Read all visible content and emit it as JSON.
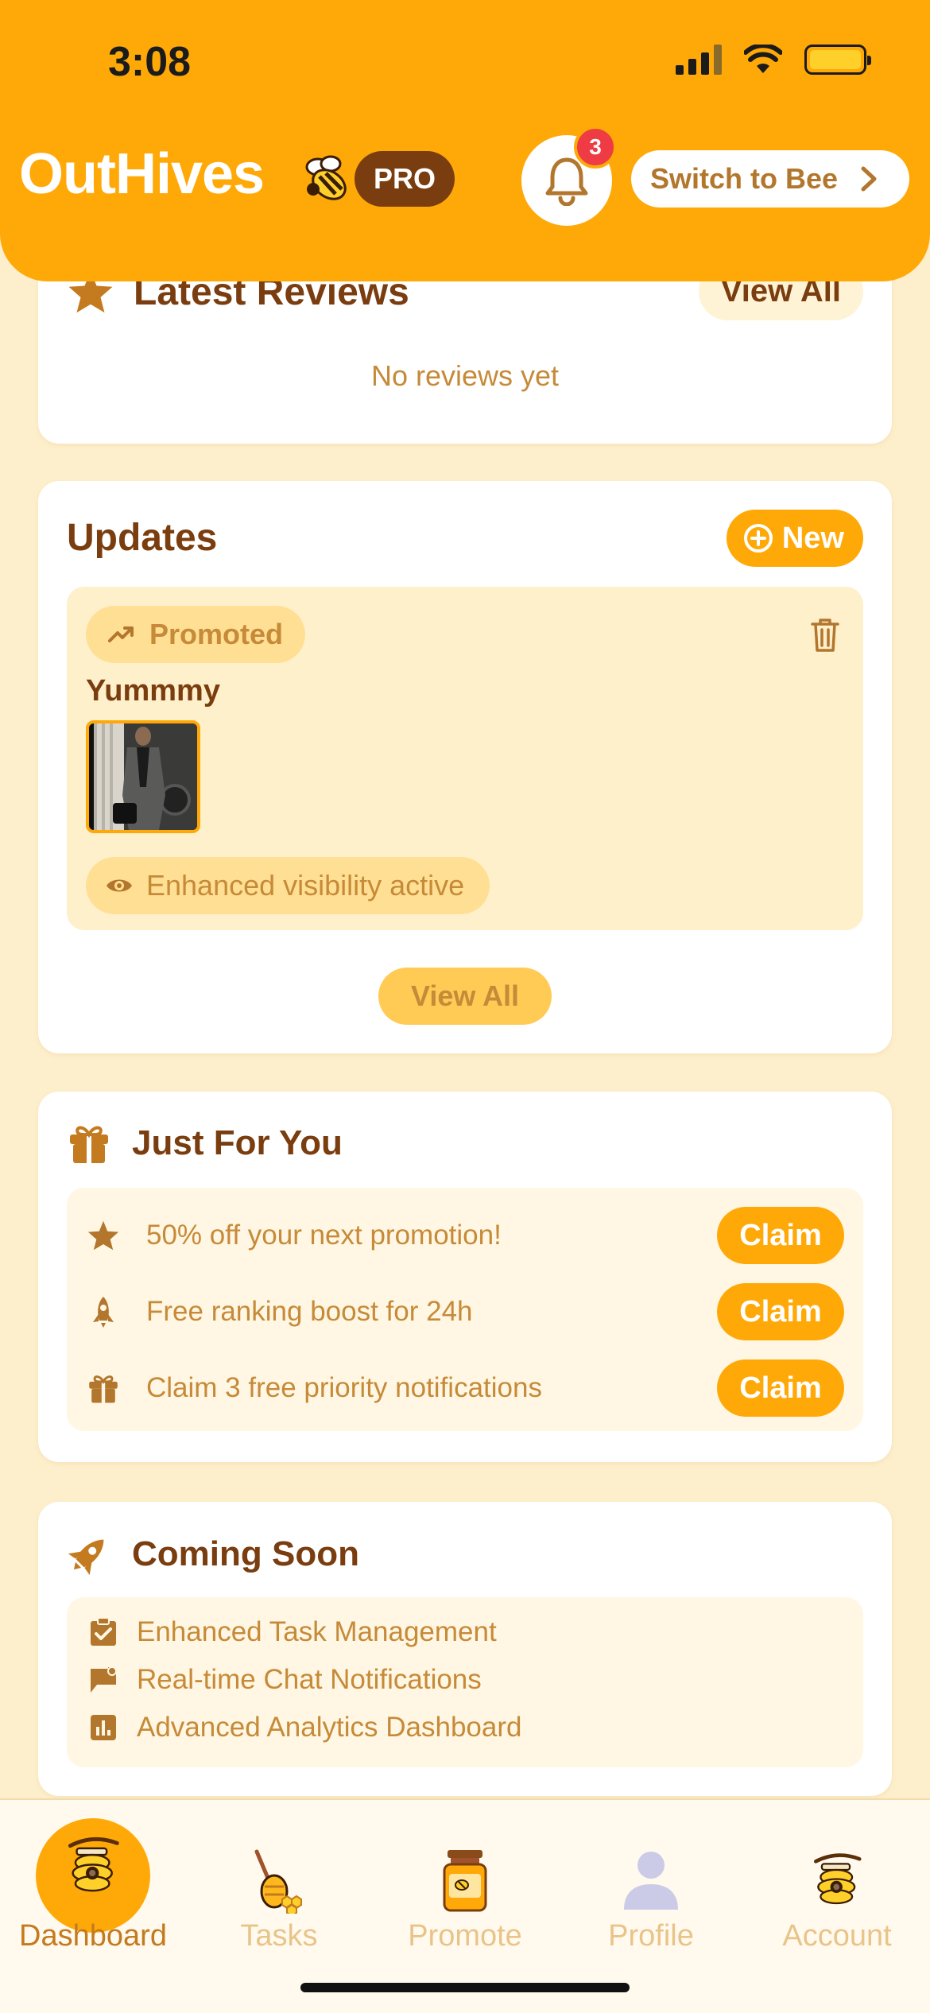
{
  "status_bar": {
    "time": "3:08"
  },
  "header": {
    "brand": "OutHives",
    "badge": "PRO",
    "notification_count": "3",
    "switch_label": "Switch to Bee"
  },
  "reviews": {
    "title": "Latest Reviews",
    "view_all": "View All",
    "empty_text": "No reviews yet"
  },
  "updates": {
    "title": "Updates",
    "new_label": "New",
    "items": [
      {
        "tag": "Promoted",
        "title": "Yummmy",
        "visibility": "Enhanced visibility active"
      }
    ],
    "view_all": "View All"
  },
  "just_for_you": {
    "title": "Just For You",
    "offers": [
      {
        "icon": "star-icon",
        "text": "50% off your next promotion!",
        "action": "Claim"
      },
      {
        "icon": "rocket-icon",
        "text": "Free ranking boost for 24h",
        "action": "Claim"
      },
      {
        "icon": "gift-icon",
        "text": "Claim 3 free priority notifications",
        "action": "Claim"
      }
    ]
  },
  "coming_soon": {
    "title": "Coming Soon",
    "items": [
      {
        "icon": "task-check-icon",
        "text": "Enhanced Task Management"
      },
      {
        "icon": "chat-flag-icon",
        "text": "Real-time Chat Notifications"
      },
      {
        "icon": "analytics-icon",
        "text": "Advanced Analytics Dashboard"
      }
    ]
  },
  "bottom_nav": {
    "items": [
      {
        "label": "Dashboard",
        "icon": "hive-icon",
        "active": true
      },
      {
        "label": "Tasks",
        "icon": "honey-dipper-icon",
        "active": false
      },
      {
        "label": "Promote",
        "icon": "honey-jar-icon",
        "active": false
      },
      {
        "label": "Profile",
        "icon": "person-icon",
        "active": false
      },
      {
        "label": "Account",
        "icon": "hive-icon",
        "active": false
      }
    ]
  },
  "colors": {
    "accent": "#ffa908",
    "brand_brown": "#7a3d0f",
    "muted_text": "#c68a38",
    "page_bg": "#fdefcb",
    "badge_red": "#ef3b43"
  }
}
